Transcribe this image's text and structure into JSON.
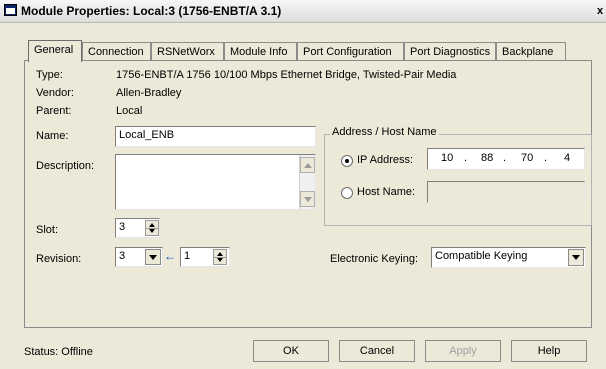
{
  "window": {
    "title": "Module Properties: Local:3 (1756-ENBT/A 3.1)",
    "close_glyph": "x"
  },
  "tabs": [
    {
      "label": "General",
      "active": true
    },
    {
      "label": "Connection"
    },
    {
      "label": "RSNetWorx"
    },
    {
      "label": "Module Info"
    },
    {
      "label": "Port Configuration"
    },
    {
      "label": "Port Diagnostics"
    },
    {
      "label": "Backplane"
    }
  ],
  "general": {
    "type_label": "Type:",
    "type_value": "1756-ENBT/A 1756 10/100 Mbps Ethernet Bridge, Twisted-Pair Media",
    "vendor_label": "Vendor:",
    "vendor_value": "Allen-Bradley",
    "parent_label": "Parent:",
    "parent_value": "Local",
    "name_label": "Name:",
    "name_value": "Local_ENB",
    "description_label": "Description:",
    "description_value": "",
    "slot_label": "Slot:",
    "slot_value": "3",
    "revision_label": "Revision:",
    "revision_major": "3",
    "revision_minor": "1",
    "keying_label": "Electronic Keying:",
    "keying_value": "Compatible Keying"
  },
  "address": {
    "group_title": "Address / Host Name",
    "ip_label": "IP Address:",
    "ip_selected": true,
    "ip_octets": [
      "10",
      "88",
      "70",
      "4"
    ],
    "host_label": "Host Name:",
    "host_value": ""
  },
  "footer": {
    "status_text": "Status:  Offline",
    "ok_label": "OK",
    "cancel_label": "Cancel",
    "apply_label": "Apply",
    "help_label": "Help"
  }
}
